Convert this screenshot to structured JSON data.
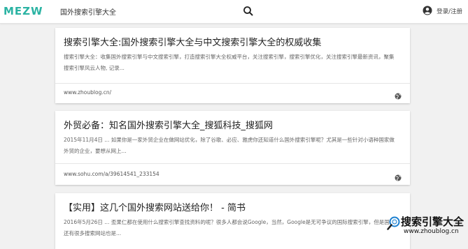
{
  "header": {
    "logo_text": "MEZW",
    "search_value": "国外搜索引擎大全",
    "search_icon": "search-icon",
    "user_icon": "account-circle-icon",
    "login_label": "登录/注册"
  },
  "results": [
    {
      "title": "搜索引擎大全:国外搜索引擎大全与中文搜索引擎大全的权威收集",
      "desc": "搜索引擎大全：收集国外搜索引擎与中文搜索引擎，打造搜索引擎大全权威平台，关注搜索引擎，搜索引擎优化，关注搜索引擎最新资讯，聚集搜索引擎风云人物, 记录...",
      "url": "www.zhoublog.cn/",
      "icon": "globe-icon"
    },
    {
      "title": "外贸必备：知名国外搜索引擎大全_搜狐科技_搜狐网",
      "desc": "2015年11月4日 ... 如果你是一家外贸企业在做网站优化，除了谷歌、必应、雅虎你还知道什么国外搜索引擎呢？尤其是一些针对小语种国家做外贸的企业，要想从网上...",
      "url": "www.sohu.com/a/39614541_233154",
      "icon": "globe-icon"
    },
    {
      "title": "【实用】这几个国外搜索网站送给你！ - 简书",
      "desc": "2016年5月26日 ... 歪果仁都在使用什么搜索引擎查找资料的呢？很多人都会说Google，当然，Google是无可争议的国际搜索引擎，但是国外还有很多搜索网站也是..."
    }
  ],
  "watermark": {
    "big": "搜索引擎大全",
    "small": "www.zhoublog.cn"
  }
}
